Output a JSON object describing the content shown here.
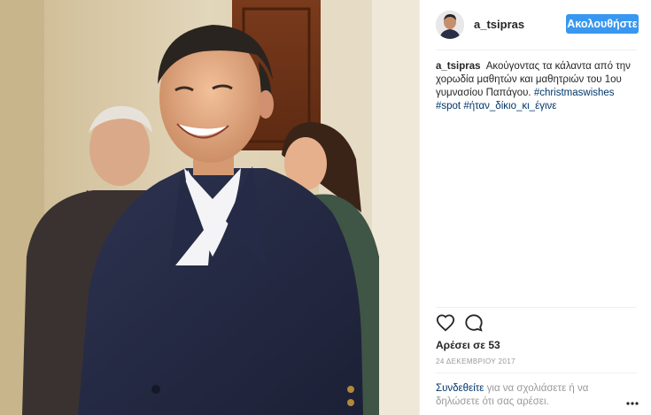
{
  "post": {
    "username": "a_tsipras",
    "follow_label": "Ακολουθήστε",
    "caption": {
      "username": "a_tsipras",
      "text": "Ακούγοντας τα κάλαντα από την χορωδία μαθητών και μαθητριών του 1ου γυμνασίου Παπάγου.",
      "hashtags": [
        "#christmaswishes",
        "#spot",
        "#ήταν_δίκιο_κι_έγινε"
      ]
    },
    "likes_text": "Αρέσει σε 53",
    "date_text": "24 ΔΕΚΕΜΒΡΙΟΥ 2017",
    "comment_prompt": {
      "login_link": "Συνδεθείτε",
      "rest": "για να σχολιάσετε ή να δηλώσετε ότι σας αρέσει."
    }
  },
  "icons": {
    "like": "heart-icon",
    "comment": "comment-bubble-icon",
    "more": "more-options-icon"
  },
  "colors": {
    "follow_button": "#3897f0",
    "link": "#003569",
    "muted": "#999999"
  }
}
